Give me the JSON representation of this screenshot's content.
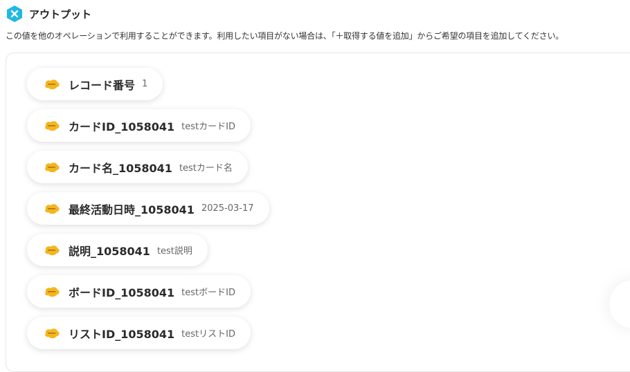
{
  "header": {
    "icon": "yoom-x-icon",
    "icon_color": "#1fb8e6",
    "title": "アウトプット"
  },
  "description": "この値を他のオペレーションで利用することができます。利用したい項目がない場合は、「＋取得する値を追加」からご希望の項目を追加してください。",
  "outputs": [
    {
      "key": "レコード番号",
      "value": "1",
      "icon": "app-logo-icon"
    },
    {
      "key": "カードID_1058041",
      "value": "testカードID",
      "icon": "app-logo-icon"
    },
    {
      "key": "カード名_1058041",
      "value": "testカード名",
      "icon": "app-logo-icon"
    },
    {
      "key": "最終活動日時_1058041",
      "value": "2025-03-17",
      "icon": "app-logo-icon"
    },
    {
      "key": "説明_1058041",
      "value": "test説明",
      "icon": "app-logo-icon"
    },
    {
      "key": "ボードID_1058041",
      "value": "testボードID",
      "icon": "app-logo-icon"
    },
    {
      "key": "リストID_1058041",
      "value": "testリストID",
      "icon": "app-logo-icon"
    }
  ],
  "colors": {
    "accent": "#1fb8e6",
    "app_icon": "#f6b51e"
  }
}
